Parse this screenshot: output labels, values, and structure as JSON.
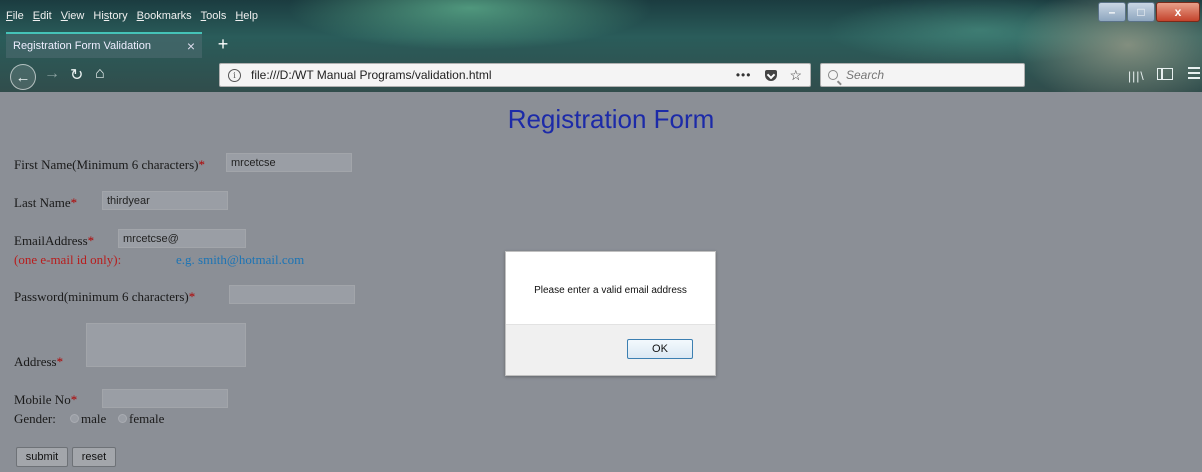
{
  "menubar": {
    "items": [
      {
        "pre": "",
        "u": "F",
        "post": "ile"
      },
      {
        "pre": "",
        "u": "E",
        "post": "dit"
      },
      {
        "pre": "",
        "u": "V",
        "post": "iew"
      },
      {
        "pre": "Hi",
        "u": "s",
        "post": "tory"
      },
      {
        "pre": "",
        "u": "B",
        "post": "ookmarks"
      },
      {
        "pre": "",
        "u": "T",
        "post": "ools"
      },
      {
        "pre": "",
        "u": "H",
        "post": "elp"
      }
    ]
  },
  "window_controls": {
    "minimize": "–",
    "maximize": "□",
    "close": "x"
  },
  "tab": {
    "title": "Registration Form Validation",
    "close": "×",
    "new_tab": "+"
  },
  "nav": {
    "back": "←",
    "forward": "→",
    "reload": "↻",
    "home": "⌂"
  },
  "urlbar": {
    "url": "file:///D:/WT Manual Programs/validation.html",
    "info": "i",
    "more": "•••",
    "star": "☆"
  },
  "search": {
    "placeholder": "Search"
  },
  "toolbar_icons": {
    "library": "|||\\"
  },
  "form": {
    "title": "Registration Form",
    "first_name": {
      "label": "First Name(Minimum 6 characters)",
      "value": "mrcetcse"
    },
    "last_name": {
      "label": "Last Name",
      "value": "thirdyear"
    },
    "email": {
      "label": "EmailAddress",
      "value": "mrcetcse@",
      "hint_red": "(one e-mail id only):",
      "hint_blue": "e.g. smith@hotmail.com"
    },
    "password": {
      "label": "Password(minimum 6 characters)",
      "value": ""
    },
    "address": {
      "label": "Address",
      "value": ""
    },
    "mobile": {
      "label": "Mobile No",
      "value": ""
    },
    "gender": {
      "label": "Gender:",
      "options": [
        "male",
        "female"
      ]
    },
    "required_mark": "*",
    "submit_label": "submit",
    "reset_label": "reset"
  },
  "dialog": {
    "message": "Please enter a valid email address",
    "ok_label": "OK"
  }
}
